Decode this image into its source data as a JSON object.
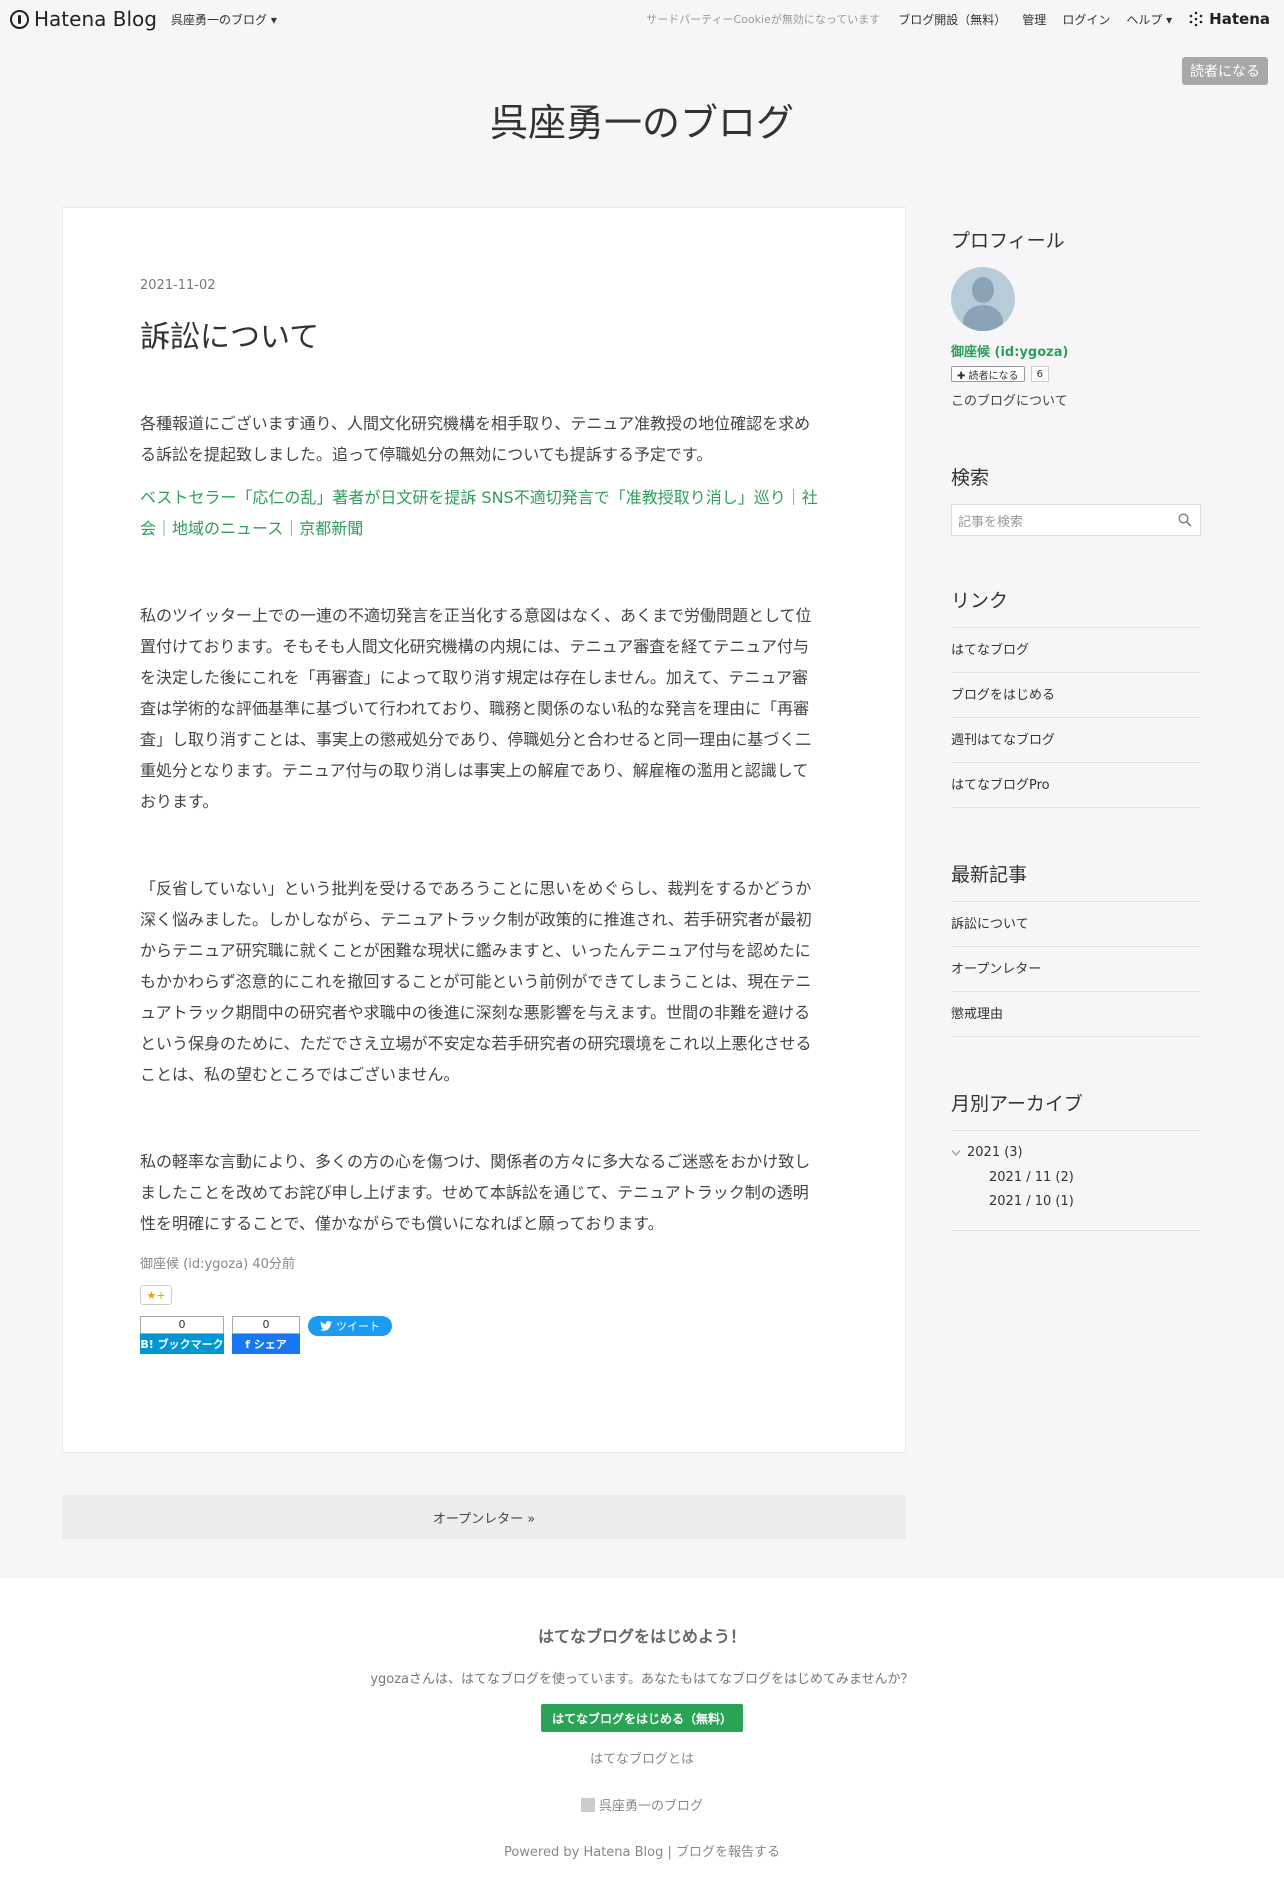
{
  "topbar": {
    "logo": "Hatena Blog",
    "blog_menu": "呉座勇一のブログ ▾",
    "cookie_notice": "サードパーティーCookieが無効になっています",
    "open_blog": "ブログ開設（無料）",
    "admin": "管理",
    "login": "ログイン",
    "help": "ヘルプ ▾",
    "hatena": "Hatena"
  },
  "subscribe_label": "読者になる",
  "blog_title": "呉座勇一のブログ",
  "article": {
    "date": "2021-11-02",
    "title": "訴訟について",
    "p1": "各種報道にございます通り、人間文化研究機構を相手取り、テニュア准教授の地位確認を求める訴訟を提起致しました。追って停職処分の無効についても提訴する予定です。",
    "link": "ベストセラー「応仁の乱」著者が日文研を提訴 SNS不適切発言で「准教授取り消し」巡り｜社会｜地域のニュース｜京都新聞",
    "p2": "私のツイッター上での一連の不適切発言を正当化する意図はなく、あくまで労働問題として位置付けております。そもそも人間文化研究機構の内規には、テニュア審査を経てテニュア付与を決定した後にこれを「再審査」によって取り消す規定は存在しません。加えて、テニュア審査は学術的な評価基準に基づいて行われており、職務と関係のない私的な発言を理由に「再審査」し取り消すことは、事実上の懲戒処分であり、停職処分と合わせると同一理由に基づく二重処分となります。テニュア付与の取り消しは事実上の解雇であり、解雇権の濫用と認識しております。",
    "p3": "「反省していない」という批判を受けるであろうことに思いをめぐらし、裁判をするかどうか深く悩みました。しかしながら、テニュアトラック制が政策的に推進され、若手研究者が最初からテニュア研究職に就くことが困難な現状に鑑みますと、いったんテニュア付与を認めたにもかかわらず恣意的にこれを撤回することが可能という前例ができてしまうことは、現在テニュアトラック期間中の研究者や求職中の後進に深刻な悪影響を与えます。世間の非難を避けるという保身のために、ただでさえ立場が不安定な若手研究者の研究環境をこれ以上悪化させることは、私の望むところではございません。",
    "p4": "私の軽率な言動により、多くの方の心を傷つけ、関係者の方々に多大なるご迷惑をおかけ致しましたことを改めてお詫び申し上げます。せめて本訴訟を通じて、テニュアトラック制の透明性を明確にすることで、僅かながらでも償いになればと願っております。",
    "author_line": "御座候 (id:ygoza) 40分前",
    "star": "★+",
    "hatena_count": "0",
    "hatena_label": "B! ブックマーク",
    "fb_count": "0",
    "fb_label": "f シェア",
    "tweet_label": "ツイート"
  },
  "pager_next": "オープンレター »",
  "sidebar": {
    "profile_heading": "プロフィール",
    "profile_name": "御座候 (id:ygoza)",
    "reader_btn": "✚ 読者になる",
    "reader_count": "6",
    "about": "このブログについて",
    "search_heading": "検索",
    "search_placeholder": "記事を検索",
    "links_heading": "リンク",
    "links": [
      "はてなブログ",
      "ブログをはじめる",
      "週刊はてなブログ",
      "はてなブログPro"
    ],
    "recent_heading": "最新記事",
    "recent": [
      "訴訟について",
      "オープンレター",
      "懲戒理由"
    ],
    "archive_heading": "月別アーカイブ",
    "archive_year": "2021 (3)",
    "archive_months": [
      "2021 / 11 (2)",
      "2021 / 10 (1)"
    ]
  },
  "footer": {
    "title": "はてなブログをはじめよう！",
    "text": "ygozaさんは、はてなブログを使っています。あなたもはてなブログをはじめてみませんか？",
    "button": "はてなブログをはじめる（無料）",
    "about": "はてなブログとは",
    "blog_name": "呉座勇一のブログ",
    "powered": "Powered by Hatena Blog | ブログを報告する"
  }
}
